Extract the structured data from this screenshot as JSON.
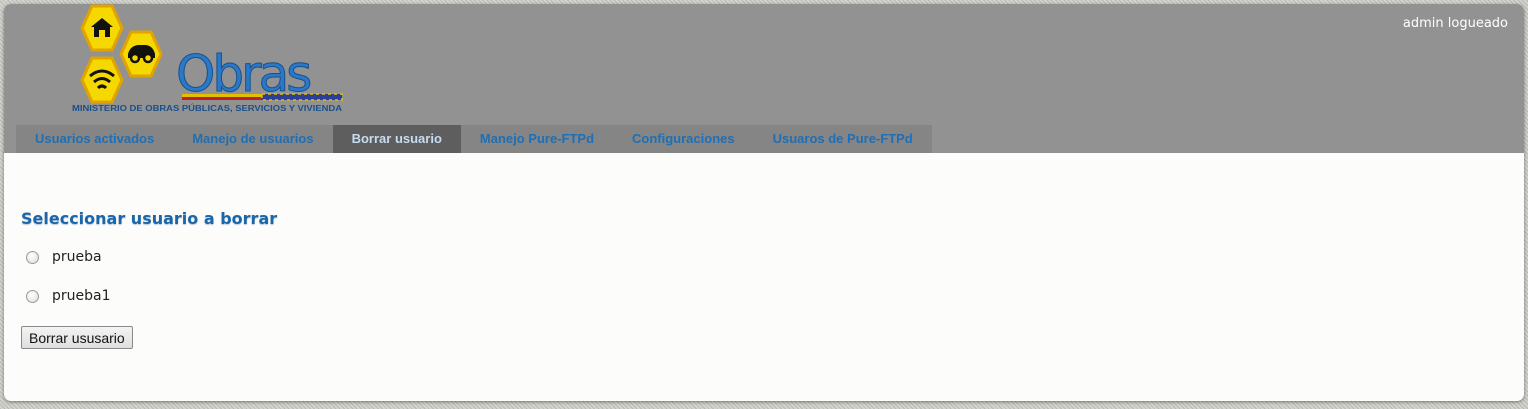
{
  "header": {
    "logo": {
      "wordmark": "Obras",
      "subtitle": "MINISTERIO DE OBRAS PÚBLICAS, SERVICIOS Y VIVIENDA",
      "icons": [
        "house-icon",
        "car-icon",
        "wifi-icon"
      ],
      "colors": {
        "hex_fill": "#f5d800",
        "hex_border": "#e0a300",
        "wordmark": "#1f6fc5"
      }
    },
    "user_status": "admin logueado"
  },
  "nav": {
    "tabs": [
      {
        "label": "Usuarios activados",
        "active": false
      },
      {
        "label": "Manejo de usuarios",
        "active": false
      },
      {
        "label": "Borrar usuario",
        "active": true
      },
      {
        "label": "Manejo Pure-FTPd",
        "active": false
      },
      {
        "label": "Configuraciones",
        "active": false
      },
      {
        "label": "Usuaros de Pure-FTPd",
        "active": false
      }
    ]
  },
  "main": {
    "heading": "Seleccionar usuario a borrar",
    "options": [
      {
        "label": "prueba",
        "checked": false
      },
      {
        "label": "prueba1",
        "checked": false
      }
    ],
    "submit_label": "Borrar ususario"
  },
  "colors": {
    "header_bg": "#929292",
    "nav_bg": "#858585",
    "tab_active_bg": "#5e5e5e",
    "link": "#1e6fb5",
    "heading": "#1a66a8"
  }
}
